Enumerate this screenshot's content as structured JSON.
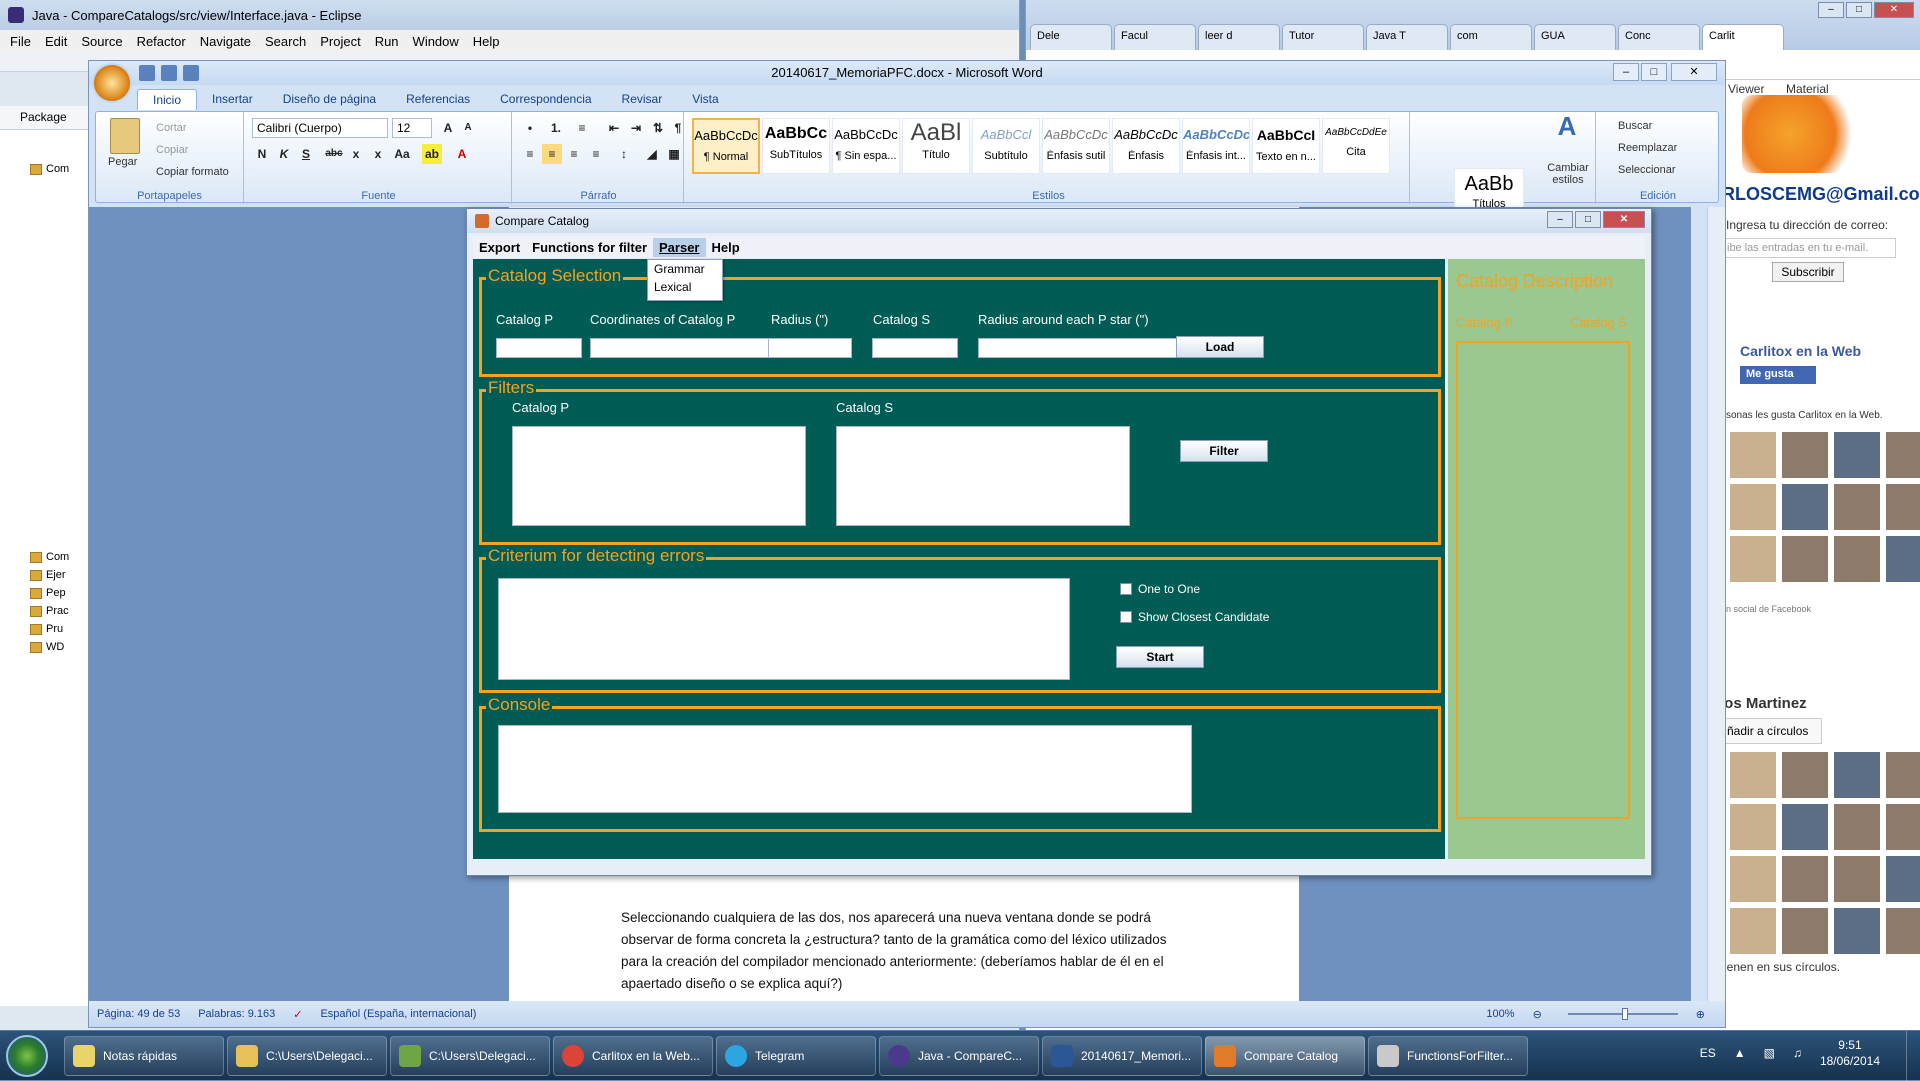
{
  "eclipse": {
    "title": "Java - CompareCatalogs/src/view/Interface.java - Eclipse",
    "menu": [
      "File",
      "Edit",
      "Source",
      "Refactor",
      "Navigate",
      "Search",
      "Project",
      "Run",
      "Window",
      "Help"
    ],
    "package_tab": "Package",
    "tree": [
      "Com",
      "Ejer",
      "Pep",
      "Prac",
      "Pru",
      "WD"
    ]
  },
  "chrome": {
    "tabs": [
      "Dele",
      "Facul",
      "leer d",
      "Tutor",
      "Java T",
      "com",
      "GUA",
      "Conc",
      "Carlit"
    ],
    "viewer": "Viewer",
    "material": "Material",
    "email_title": "RLOSCEMG@Gmail.co",
    "email_prompt": "Ingresa tu dirección de correo:",
    "email_placeholder": "ibe las entradas en tu e-mail.",
    "subscribe": "Subscribir",
    "fb_title": "Carlitox en la Web",
    "fb_like": "Me gusta",
    "fb_people": "sonas les gusta Carlitox en la Web.",
    "fb_social": "n social de Facebook",
    "gplus_name": "los Martinez",
    "gplus_button": "ñadir a círculos",
    "gplus_footer": "ienen en sus círculos."
  },
  "word": {
    "title": "20140617_MemoriaPFC.docx - Microsoft Word",
    "tabs": [
      "Inicio",
      "Insertar",
      "Diseño de página",
      "Referencias",
      "Correspondencia",
      "Revisar",
      "Vista"
    ],
    "clipboard": {
      "paste": "Pegar",
      "cut": "Cortar",
      "copy": "Copiar",
      "format": "Copiar formato",
      "label": "Portapapeles"
    },
    "font": {
      "name": "Calibri (Cuerpo)",
      "size": "12",
      "label": "Fuente"
    },
    "paragraph_label": "Párrafo",
    "styles": [
      {
        "sample": "AaBbCcDc",
        "name": "¶ Normal"
      },
      {
        "sample": "AaBbCc",
        "name": "SubTítulos"
      },
      {
        "sample": "AaBbCcDc",
        "name": "¶ Sin espa..."
      },
      {
        "sample": "AaBl",
        "name": "Título"
      },
      {
        "sample": "AaBbCcl",
        "name": "Subtítulo"
      },
      {
        "sample": "AaBbCcDc",
        "name": "Énfasis sutil"
      },
      {
        "sample": "AaBbCcDc",
        "name": "Énfasis"
      },
      {
        "sample": "AaBbCcDc",
        "name": "Énfasis int..."
      },
      {
        "sample": "AaBbCcI",
        "name": "Texto en n..."
      },
      {
        "sample": "AaBbCcDdEe",
        "name": "Cita"
      },
      {
        "sample": "AaBb",
        "name": "Títulos"
      }
    ],
    "styles_label": "Estilos",
    "change_styles": "Cambiar estilos",
    "edit": {
      "find": "Buscar",
      "replace": "Reemplazar",
      "select": "Seleccionar",
      "label": "Edición"
    },
    "page_text": "Seleccionando cualquiera de las dos, nos aparecerá una nueva ventana donde se podrá observar de forma concreta la ¿estructura? tanto de la gramática como del léxico utilizados para la creación del compilador mencionado anteriormente: (deberíamos hablar de él en el apaertado diseño o se explica aquí?)",
    "status": {
      "page": "Página: 49 de 53",
      "words": "Palabras: 9.163",
      "lang": "Español (España, internacional)",
      "zoom": "100%"
    }
  },
  "compare": {
    "title": "Compare Catalog",
    "menu": [
      "Export",
      "Functions for filter",
      "Parser",
      "Help"
    ],
    "open_menu_items": [
      "Grammar",
      "Lexical"
    ],
    "selection": {
      "title": "Catalog Selection",
      "catalog_p": "Catalog P",
      "coords": "Coordinates of Catalog P",
      "radius": "Radius (\")",
      "catalog_s": "Catalog S",
      "radius_each": "Radius around each P star (\")",
      "load": "Load"
    },
    "filters": {
      "title": "Filters",
      "catalog_p": "Catalog P",
      "catalog_s": "Catalog S",
      "filter": "Filter"
    },
    "criterium": {
      "title": "Criterium for detecting errors",
      "one_to_one": "One to One",
      "closest": "Show Closest Candidate",
      "start": "Start"
    },
    "console": {
      "title": "Console"
    },
    "description": {
      "title": "Catalog Description",
      "catalog_p": "Catalog P",
      "catalog_s": "Catalog S"
    }
  },
  "taskbar": {
    "items": [
      {
        "label": "Notas rápidas",
        "color": "#e9d36a"
      },
      {
        "label": "C:\\Users\\Delegaci...",
        "color": "#e6c15a"
      },
      {
        "label": "C:\\Users\\Delegaci...",
        "color": "#6fa544"
      },
      {
        "label": "Carlitox en la Web...",
        "color": "#db4437"
      },
      {
        "label": "Telegram",
        "color": "#2ca5e0"
      },
      {
        "label": "Java - CompareC...",
        "color": "#4b3a8c"
      },
      {
        "label": "20140617_Memori...",
        "color": "#2b5797"
      },
      {
        "label": "Compare Catalog",
        "color": "#e07b2a"
      },
      {
        "label": "FunctionsForFilter...",
        "color": "#c9c9c9"
      }
    ],
    "lang": "ES",
    "time": "9:51",
    "date": "18/06/2014"
  }
}
